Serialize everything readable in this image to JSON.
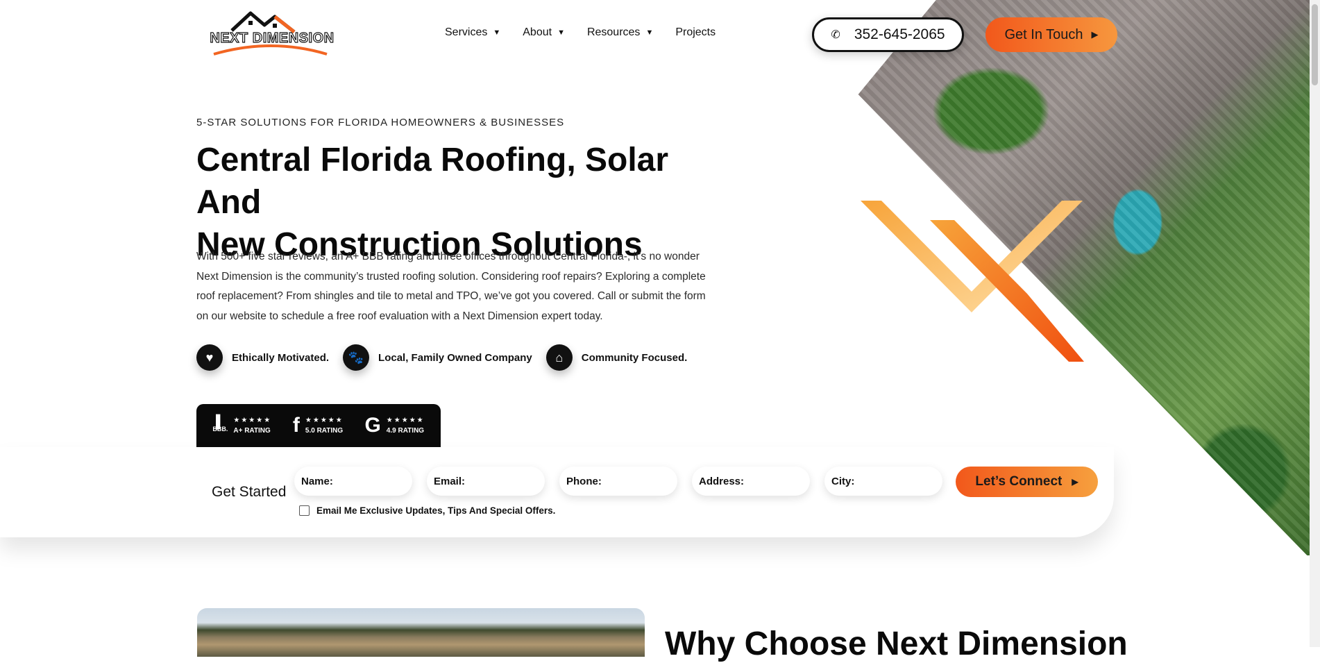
{
  "header": {
    "logo_text": "NEXT DIMENSION",
    "nav": [
      {
        "label": "Services",
        "has_dropdown": true
      },
      {
        "label": "About",
        "has_dropdown": true
      },
      {
        "label": "Resources",
        "has_dropdown": true
      },
      {
        "label": "Projects",
        "has_dropdown": false
      }
    ],
    "phone": "352-645-2065",
    "cta_label": "Get In Touch"
  },
  "hero": {
    "eyebrow": "5-STAR SOLUTIONS FOR FLORIDA HOMEOWNERS & BUSINESSES",
    "headline_line1": "Central Florida Roofing, Solar And",
    "headline_line2": "New Construction Solutions",
    "intro": "With 500+ five star reviews, an A+ BBB rating and three offices throughout Central Florida-, it’s no wonder Next Dimension is the community’s trusted roofing solution. Considering roof repairs? Exploring a complete roof replacement? From shingles and tile to metal and TPO, we’ve got you covered. Call or submit the form on our website to schedule a free roof evaluation with a Next Dimension expert today.",
    "values": [
      {
        "icon": "heart-icon",
        "label": "Ethically Motivated."
      },
      {
        "icon": "family-icon",
        "label": "Local, Family Owned Company"
      },
      {
        "icon": "community-icon",
        "label": "Community Focused."
      }
    ]
  },
  "ratings": [
    {
      "source": "BBB",
      "mark": "BBB.",
      "stars": "★★★★★",
      "label": "A+ RATING"
    },
    {
      "source": "Facebook",
      "mark": "f",
      "stars": "★★★★★",
      "label": "5.0 RATING"
    },
    {
      "source": "Google",
      "mark": "G",
      "stars": "★★★★★",
      "label": "4.9 RATING"
    }
  ],
  "form": {
    "title": "Get Started",
    "fields": {
      "name": "Name:",
      "email": "Email:",
      "phone": "Phone:",
      "address": "Address:",
      "city": "City:"
    },
    "submit_label": "Let’s Connect",
    "optin_label": "Email Me Exclusive Updates, Tips And Special Offers.",
    "optin_checked": false
  },
  "next_section": {
    "title": "Why Choose Next Dimension"
  },
  "colors": {
    "accent_orange": "#f2581b",
    "accent_orange_light": "#f6a03e",
    "dark": "#0a0a0a"
  }
}
